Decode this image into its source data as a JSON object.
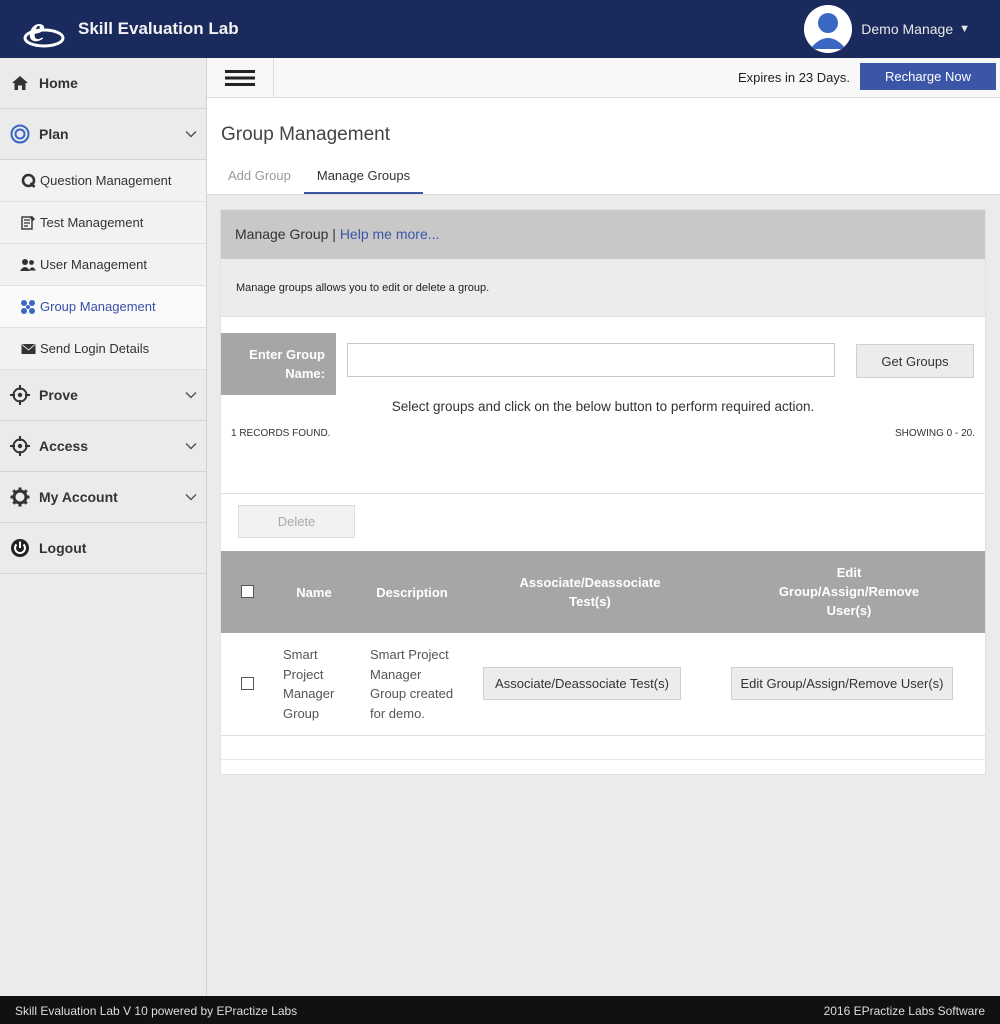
{
  "app": {
    "title": "Skill Evaluation Lab"
  },
  "user": {
    "name": "Demo Manage"
  },
  "colors": {
    "topbar": "#1b2a5c",
    "accent": "#3b56a7",
    "table_header": "#a6a6a6"
  },
  "sidebar": {
    "items": [
      {
        "label": "Home",
        "icon": "home-icon"
      },
      {
        "label": "Plan",
        "icon": "target-icon",
        "expanded": true,
        "children": [
          {
            "label": "Question Management",
            "icon": "question-icon"
          },
          {
            "label": "Test Management",
            "icon": "test-icon"
          },
          {
            "label": "User Management",
            "icon": "users-icon"
          },
          {
            "label": "Group Management",
            "icon": "group-icon",
            "active": true
          },
          {
            "label": "Send Login Details",
            "icon": "envelope-icon"
          }
        ]
      },
      {
        "label": "Prove",
        "icon": "crosshair-icon"
      },
      {
        "label": "Access",
        "icon": "crosshair-icon"
      },
      {
        "label": "My Account",
        "icon": "gear-icon"
      },
      {
        "label": "Logout",
        "icon": "power-icon"
      }
    ]
  },
  "toolbar": {
    "expires": "Expires in 23 Days.",
    "recharge": "Recharge Now"
  },
  "page": {
    "title": "Group Management",
    "tabs": [
      {
        "label": "Add Group",
        "active": false
      },
      {
        "label": "Manage Groups",
        "active": true
      }
    ]
  },
  "panel": {
    "header": "Manage Group |",
    "help_link": "Help me more...",
    "description": "Manage groups allows you to edit or delete a group.",
    "search_label_line1": "Enter Group",
    "search_label_line2": "Name:",
    "search_value": "",
    "get_groups": "Get Groups",
    "hint": "Select groups and click on the below button to perform required action.",
    "records_found": "1 RECORDS FOUND.",
    "showing": "SHOWING 0 - 20.",
    "delete": "Delete"
  },
  "table": {
    "columns": {
      "name": "Name",
      "description": "Description",
      "associate_line1": "Associate/Deassociate",
      "associate_line2": "Test(s)",
      "edit_line1": "Edit",
      "edit_line2": "Group/Assign/Remove",
      "edit_line3": "User(s)"
    },
    "rows": [
      {
        "name_lines": [
          "Smart",
          "Project",
          "Manager",
          "Group"
        ],
        "description_lines": [
          "Smart Project",
          "Manager",
          "Group created",
          "for demo."
        ],
        "associate_button": "Associate/Deassociate Test(s)",
        "edit_button": "Edit Group/Assign/Remove User(s)"
      }
    ]
  },
  "footer": {
    "left": "Skill Evaluation Lab V 10 powered by EPractize Labs",
    "right": "2016 EPractize Labs Software"
  }
}
